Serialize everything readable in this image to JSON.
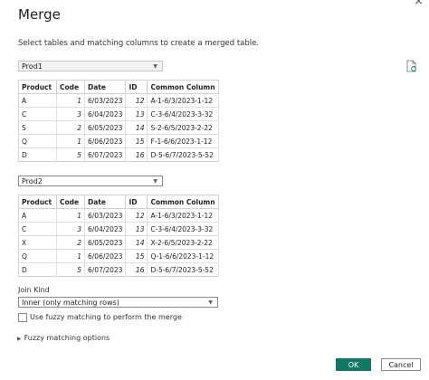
{
  "dialog": {
    "title": "Merge",
    "subtitle": "Select tables and matching columns to create a merged table.",
    "close_glyph": "×"
  },
  "table1": {
    "selected": "Prod1",
    "columns": [
      "Product",
      "Code",
      "Date",
      "ID",
      "Common Column"
    ],
    "rows": [
      [
        "A",
        "1",
        "6/03/2023",
        "12",
        "A-1-6/3/2023-1-12"
      ],
      [
        "C",
        "3",
        "6/04/2023",
        "13",
        "C-3-6/4/2023-3-32"
      ],
      [
        "S",
        "2",
        "6/05/2023",
        "14",
        "S-2-6/5/2023-2-22"
      ],
      [
        "Q",
        "1",
        "6/06/2023",
        "15",
        "F-1-6/6/2023-1-12"
      ],
      [
        "D",
        "5",
        "6/07/2023",
        "16",
        "D-5-6/7/2023-5-52"
      ]
    ]
  },
  "table2": {
    "selected": "Prod2",
    "columns": [
      "Product",
      "Code",
      "Date",
      "ID",
      "Common Column"
    ],
    "rows": [
      [
        "A",
        "1",
        "6/03/2023",
        "12",
        "A-1-6/3/2023-1-12"
      ],
      [
        "C",
        "3",
        "6/04/2023",
        "13",
        "C-3-6/4/2023-3-32"
      ],
      [
        "X",
        "2",
        "6/05/2023",
        "14",
        "X-2-6/5/2023-2-22"
      ],
      [
        "Q",
        "1",
        "6/06/2023",
        "15",
        "Q-1-6/6/2023-1-12"
      ],
      [
        "D",
        "5",
        "6/07/2023",
        "16",
        "D-5-6/7/2023-5-52"
      ]
    ]
  },
  "join": {
    "label": "Join Kind",
    "selected": "Inner (only matching rows)"
  },
  "fuzzy": {
    "checkbox_label": "Use fuzzy matching to perform the merge",
    "checked": false,
    "options_label": "Fuzzy matching options"
  },
  "buttons": {
    "ok": "OK",
    "cancel": "Cancel"
  },
  "colors": {
    "accent": "#117865",
    "border": "#d1d1d1"
  }
}
